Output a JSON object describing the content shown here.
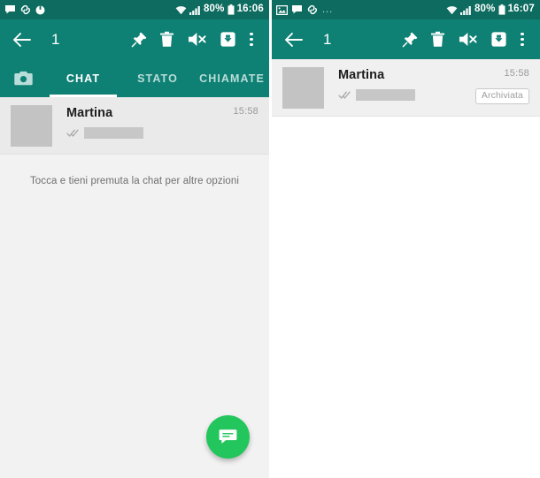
{
  "panels": [
    {
      "id": "left",
      "statusbar": {
        "left_icons": [
          "message-bubble-icon",
          "link-icon",
          "circle-icon"
        ],
        "dots": "",
        "wifi_icon": "wifi-icon",
        "signal_icon": "signal-bars-icon",
        "battery_text": "80%",
        "battery_icon": "battery-icon",
        "time": "16:06"
      },
      "toolbar": {
        "back_icon": "back-arrow-icon",
        "selection_count": "1",
        "actions": [
          {
            "name": "pin-button",
            "icon": "pin-icon"
          },
          {
            "name": "delete-button",
            "icon": "trash-icon"
          },
          {
            "name": "mute-button",
            "icon": "mute-speaker-icon"
          },
          {
            "name": "archive-button",
            "icon": "archive-box-icon"
          },
          {
            "name": "overflow-menu-button",
            "icon": "more-vertical-icon"
          }
        ]
      },
      "tabs": {
        "camera_icon": "camera-icon",
        "items": [
          {
            "label": "CHAT",
            "active": true
          },
          {
            "label": "STATO",
            "active": false
          },
          {
            "label": "CHIAMATE",
            "active": false
          }
        ]
      },
      "chat_row": {
        "avatar": "contact-avatar",
        "name": "Martina",
        "check_icon": "double-check-icon",
        "message_redacted": true,
        "time": "15:58",
        "badge": null
      },
      "hint": "Tocca e tieni premuta la chat per altre opzioni",
      "fab": {
        "icon": "new-chat-icon",
        "color": "#22c65c"
      }
    },
    {
      "id": "right",
      "statusbar": {
        "left_icons": [
          "image-icon",
          "message-bubble-icon",
          "link-icon"
        ],
        "dots": "...",
        "wifi_icon": "wifi-icon",
        "signal_icon": "signal-bars-icon",
        "battery_text": "80%",
        "battery_icon": "battery-icon",
        "time": "16:07"
      },
      "toolbar": {
        "back_icon": "back-arrow-icon",
        "selection_count": "1",
        "actions": [
          {
            "name": "pin-button",
            "icon": "pin-icon"
          },
          {
            "name": "delete-button",
            "icon": "trash-icon"
          },
          {
            "name": "mute-button",
            "icon": "mute-speaker-icon"
          },
          {
            "name": "archive-button",
            "icon": "archive-box-icon"
          },
          {
            "name": "overflow-menu-button",
            "icon": "more-vertical-icon"
          }
        ]
      },
      "chat_row": {
        "avatar": "contact-avatar",
        "name": "Martina",
        "check_icon": "double-check-icon",
        "message_redacted": true,
        "time": "15:58",
        "badge": "Archiviata"
      }
    }
  ],
  "colors": {
    "statusbar": "#0d6b5f",
    "toolbar": "#0f8074",
    "accent_green": "#22c65c",
    "selected_row": "#eaeaea",
    "page_bg": "#f2f2f2"
  }
}
